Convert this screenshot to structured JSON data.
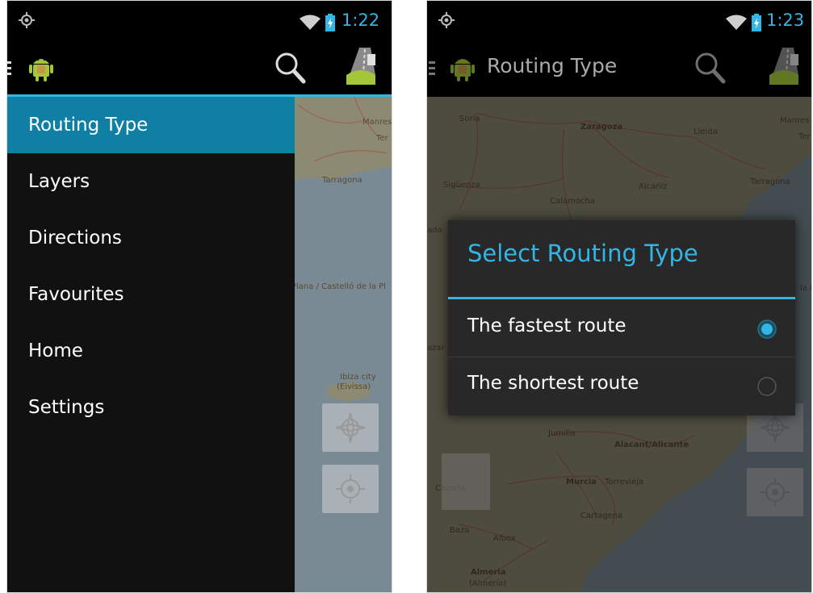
{
  "screen_left": {
    "clock": "1:22",
    "drawer": {
      "items": [
        {
          "label": "Routing Type",
          "selected": true
        },
        {
          "label": "Layers",
          "selected": false
        },
        {
          "label": "Directions",
          "selected": false
        },
        {
          "label": "Favourites",
          "selected": false
        },
        {
          "label": "Home",
          "selected": false
        },
        {
          "label": "Settings",
          "selected": false
        }
      ]
    },
    "map_labels": [
      "Manres",
      "Ter",
      "Tarragona",
      "Plana / Castelló de la Pl",
      "Ibiza city",
      "(Eivissa)"
    ]
  },
  "screen_right": {
    "clock": "1:23",
    "action_bar_title": "Routing Type",
    "dialog": {
      "title": "Select Routing Type",
      "options": [
        {
          "label": "The fastest route",
          "checked": true
        },
        {
          "label": "The shortest route",
          "checked": false
        }
      ]
    },
    "map_labels": [
      "Soria",
      "Zaragoza",
      "Lleida",
      "Manres",
      "Ter",
      "Tarragona",
      "Sigüenza",
      "Alcañiz",
      "Calamocha",
      "ada",
      "la Pl",
      "azar",
      "Jumilla",
      "Alacant/Alicante",
      "Murcia",
      "Torrevieja",
      "Cazorla",
      "Cartagena",
      "Baza",
      "Albox",
      "Almeria",
      "(Almería)"
    ]
  },
  "colors": {
    "accent": "#33b5e5",
    "drawer_selected": "#0f7fa3",
    "drawer_bg": "#111111",
    "dialog_bg": "#282828",
    "map_land": "#8c8a73",
    "map_sea": "#7a8a94"
  },
  "icons": [
    "gps-icon",
    "wifi-icon",
    "battery-charging-icon",
    "drawer-indicator-icon",
    "android-app-icon",
    "search-icon",
    "route-app-icon",
    "compass-icon",
    "locate-icon",
    "radio-checked-icon",
    "radio-unchecked-icon"
  ]
}
